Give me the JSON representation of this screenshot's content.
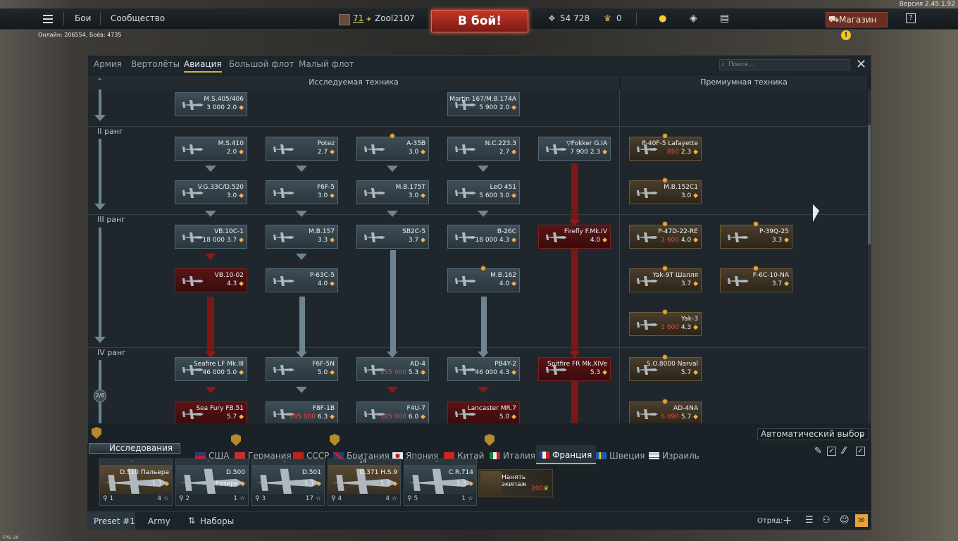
{
  "version": "Версия 2.45.1.92",
  "top": {
    "battles": "Бои",
    "community": "Сообщество",
    "level": "71",
    "nickname": "Zool2107",
    "to_battle": "В бой!",
    "silver": "54 728",
    "gold": "0",
    "shop": "Магазин"
  },
  "online": "Онлайн: 206554, Боёв: 4735",
  "tabs": [
    "Армия",
    "Вертолёты",
    "Авиация",
    "Большой флот",
    "Малый флот"
  ],
  "active_tab": "Авиация",
  "search_placeholder": "Поиск...",
  "headers": {
    "researched": "Исследуемая техника",
    "premium": "Премиумная техника"
  },
  "ranks": [
    "II ранг",
    "III ранг",
    "IV ранг"
  ],
  "rank_counter": "2/6",
  "cards": [
    {
      "id": "c1",
      "name": "M.S.405/406",
      "val": "3 000",
      "br": "2.0"
    },
    {
      "id": "c2",
      "name": "Martin 167/M.B.174A",
      "val": "5 900",
      "br": "2.0"
    },
    {
      "id": "c3",
      "name": "M.S.410",
      "val": "",
      "br": "2.0"
    },
    {
      "id": "c4",
      "name": "Potez",
      "val": "",
      "br": "2.7"
    },
    {
      "id": "c5",
      "name": "A-35B",
      "val": "",
      "br": "3.0"
    },
    {
      "id": "c6",
      "name": "N.C.223.3",
      "val": "",
      "br": "2.7"
    },
    {
      "id": "c7",
      "name": "▽Fokker G.IA",
      "val": "7 900",
      "br": "2.3"
    },
    {
      "id": "c8",
      "name": "P-40F-5 Lafayette",
      "val": "850",
      "br": "2.3"
    },
    {
      "id": "c9",
      "name": "V.G.33C/D.520",
      "val": "",
      "br": "3.0"
    },
    {
      "id": "c10",
      "name": "F6F-5",
      "val": "",
      "br": "3.0"
    },
    {
      "id": "c11",
      "name": "M.B.175T",
      "val": "",
      "br": "3.0"
    },
    {
      "id": "c12",
      "name": "LeO 451",
      "val": "5 600",
      "br": "3.0"
    },
    {
      "id": "c13",
      "name": "M.B.152C1",
      "val": "",
      "br": "3.0"
    },
    {
      "id": "c14",
      "name": "VB.10C-1",
      "val": "18 000",
      "br": "3.7"
    },
    {
      "id": "c15",
      "name": "M.B.157",
      "val": "",
      "br": "3.3"
    },
    {
      "id": "c16",
      "name": "SB2C-5",
      "val": "",
      "br": "3.7"
    },
    {
      "id": "c17",
      "name": "B-26C",
      "val": "18 000",
      "br": "4.3"
    },
    {
      "id": "c18",
      "name": "Firefly F.Mk.IV",
      "val": "",
      "br": "4.0"
    },
    {
      "id": "c19",
      "name": "P-47D-22-RE",
      "val": "1 600",
      "br": "4.0"
    },
    {
      "id": "c20",
      "name": "P-39Q-25",
      "val": "",
      "br": "3.3"
    },
    {
      "id": "c21",
      "name": "VB.10-02",
      "val": "",
      "br": "4.3"
    },
    {
      "id": "c22",
      "name": "P-63C-5",
      "val": "",
      "br": "4.0"
    },
    {
      "id": "c23",
      "name": "M.B.162",
      "val": "",
      "br": "4.0"
    },
    {
      "id": "c24",
      "name": "Yak-9T Шалля",
      "val": "",
      "br": "3.7"
    },
    {
      "id": "c25",
      "name": "F-6C-10-NA",
      "val": "",
      "br": "3.7"
    },
    {
      "id": "c26",
      "name": "Yak-3",
      "val": "1 600",
      "br": "4.3"
    },
    {
      "id": "c27",
      "name": "Seafire LF Mk.III",
      "val": "46 000",
      "br": "5.0"
    },
    {
      "id": "c28",
      "name": "F6F-5N",
      "val": "",
      "br": "5.0"
    },
    {
      "id": "c29",
      "name": "AD-4",
      "val": "355 000",
      "br": "5.3"
    },
    {
      "id": "c30",
      "name": "PB4Y-2",
      "val": "46 000",
      "br": "4.3"
    },
    {
      "id": "c31",
      "name": "Spitfire FR Mk.XIVe",
      "val": "",
      "br": "5.3"
    },
    {
      "id": "c32",
      "name": "S.O.8000 Narval",
      "val": "",
      "br": "5.7"
    },
    {
      "id": "c33",
      "name": "Sea Fury FB.51",
      "val": "",
      "br": "5.7"
    },
    {
      "id": "c34",
      "name": "F8F-1B",
      "val": "185 000",
      "br": "6.3"
    },
    {
      "id": "c35",
      "name": "F4U-7",
      "val": "185 000",
      "br": "6.0"
    },
    {
      "id": "c36",
      "name": "Lancaster MR.7",
      "val": "",
      "br": "5.0"
    },
    {
      "id": "c37",
      "name": "AD-4NA",
      "val": "6 090",
      "br": "5.7"
    }
  ],
  "auto_select": "Автоматический выбор",
  "research_label": "Исследования",
  "nations": [
    "США",
    "Германия",
    "СССР",
    "Британия",
    "Япония",
    "Китай",
    "Италия",
    "Франция",
    "Швеция",
    "Израиль"
  ],
  "active_nation": "Франция",
  "slots": [
    {
      "name": "D.510 Пальера",
      "br": "1.7",
      "num": "1",
      "crew": "4"
    },
    {
      "name": "D.500",
      "br": "Резерв",
      "num": "2",
      "crew": "1"
    },
    {
      "name": "D.501",
      "br": "1.7",
      "num": "3",
      "crew": "17"
    },
    {
      "name": "D.371 H.S.9",
      "br": "1.7",
      "num": "4",
      "crew": "4",
      "top": "14"
    },
    {
      "name": "C.R.714",
      "br": "1.3",
      "num": "5",
      "crew": "1"
    }
  ],
  "hire_crew": {
    "label": "Нанять экипаж",
    "cost": "200"
  },
  "footer": {
    "preset": "Preset #1",
    "army": "Army",
    "sets": "Наборы",
    "squad": "Отряд:"
  },
  "fps": "FPS: 29"
}
